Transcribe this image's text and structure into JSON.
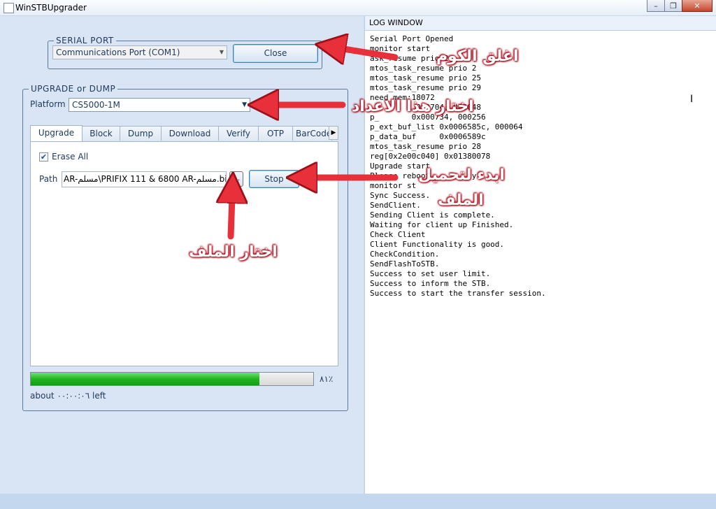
{
  "window": {
    "title": "WinSTBUpgrader",
    "minimize_glyph": "–",
    "maximize_glyph": "❐",
    "close_glyph": "✕"
  },
  "serial_port": {
    "group_title": "SERIAL PORT",
    "port_value": "Communications Port (COM1)",
    "close_label": "Close"
  },
  "upgrade": {
    "group_title": "UPGRADE or DUMP",
    "platform_label": "Platform",
    "platform_value": "CS5000-1M",
    "tabs": [
      "Upgrade",
      "Block",
      "Dump",
      "Download",
      "Verify",
      "OTP",
      "BarCode"
    ],
    "active_tab": "Upgrade",
    "erase_all_label": "Erase All",
    "erase_all_checked": true,
    "path_label": "Path",
    "path_value": "\\PRIFIX 111 & 6800 AR-مسلم.bin",
    "path_prefix": "AR-مسلم",
    "browse_label": "...",
    "stop_label": "Stop",
    "progress_percent": 81,
    "progress_text": "٨١٪",
    "time_left": "about ٠٠:٠٠:٠٦ left"
  },
  "log": {
    "header": "LOG WINDOW",
    "lines": [
      "Serial Port Opened",
      "monitor start",
      "ask_resume prio 2",
      "mtos_task_resume prio 2",
      "mtos_task_resume prio 25",
      "mtos_task_resume prio 29",
      "need_mem:18072",
      "          0x0704, 000048",
      "p_       0x000734, 000256",
      "p_ext_buf_list 0x0006585c, 000064",
      "p_data_buf     0x0006589c",
      "mtos_task_resume prio 28",
      "reg[0x2e00c040] 0x01380078",
      "Upgrade start",
      "Please reboot         y.",
      "monitor st",
      "Sync Success.",
      "SendClient.",
      "Sending Client is complete.",
      "Waiting for client up Finished.",
      "Check Client",
      "Client Functionality is good.",
      "CheckCondition.",
      "SendFlashToSTB.",
      "Success to set user limit.",
      "Success to inform the STB.",
      "Success to start the transfer session."
    ]
  },
  "annotations": {
    "close_port": "اغلق الكوم",
    "choose_setting": "اختار هذا الاعداد",
    "start_loading_1": "ابدء لتحميل",
    "start_loading_2": "الملف",
    "choose_file": "اختار الملف"
  },
  "colors": {
    "arrow": "#e8303a",
    "progress_fill": "#22b522",
    "accent": "#1e395b"
  }
}
